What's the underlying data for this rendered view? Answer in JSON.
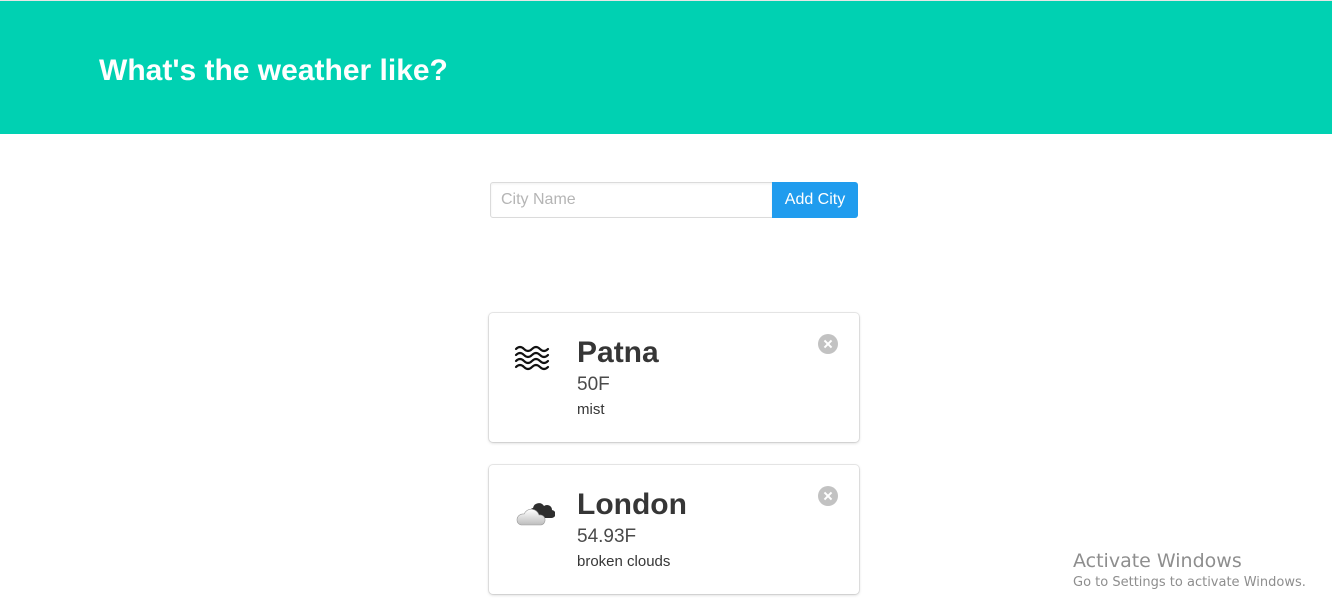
{
  "hero": {
    "title": "What's the weather like?"
  },
  "form": {
    "placeholder": "City Name",
    "value": "",
    "button_label": "Add City"
  },
  "cards": [
    {
      "city": "Patna",
      "temperature": "50F",
      "description": "mist",
      "icon": "mist-icon"
    },
    {
      "city": "London",
      "temperature": "54.93F",
      "description": "broken clouds",
      "icon": "broken-clouds-icon"
    }
  ],
  "watermark": {
    "title": "Activate Windows",
    "subtitle": "Go to Settings to activate Windows."
  },
  "colors": {
    "hero": "#00d1b2",
    "button": "#209cee",
    "delete": "#c2c2c2"
  }
}
